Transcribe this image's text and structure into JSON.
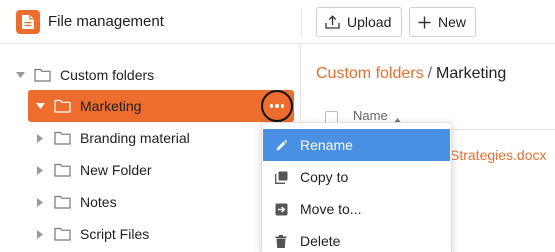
{
  "app": {
    "title": "File management",
    "logo_icon": "document-icon",
    "accent_color": "#ec6d2e"
  },
  "toolbar": {
    "upload_label": "Upload",
    "new_label": "New"
  },
  "tree": {
    "root": {
      "label": "Custom folders",
      "expanded": true
    },
    "items": [
      {
        "label": "Marketing",
        "expanded": true,
        "selected": true
      },
      {
        "label": "Branding material",
        "expanded": false
      },
      {
        "label": "New Folder",
        "expanded": false
      },
      {
        "label": "Notes",
        "expanded": false
      },
      {
        "label": "Script Files",
        "expanded": false
      }
    ],
    "more_icon": "more-horizontal-icon"
  },
  "breadcrumb": {
    "root": "Custom folders",
    "separator": "/",
    "current": "Marketing"
  },
  "file_list": {
    "column_name": "Name",
    "sort": "ascending",
    "visible_file_fragment": "Strategies.docx"
  },
  "context_menu": {
    "items": [
      {
        "label": "Rename",
        "icon": "pencil-icon",
        "active": true
      },
      {
        "label": "Copy to",
        "icon": "copy-icon",
        "active": false
      },
      {
        "label": "Move to...",
        "icon": "move-icon",
        "active": false
      },
      {
        "label": "Delete",
        "icon": "trash-icon",
        "active": false
      }
    ],
    "highlight_color": "#4a90e2"
  }
}
